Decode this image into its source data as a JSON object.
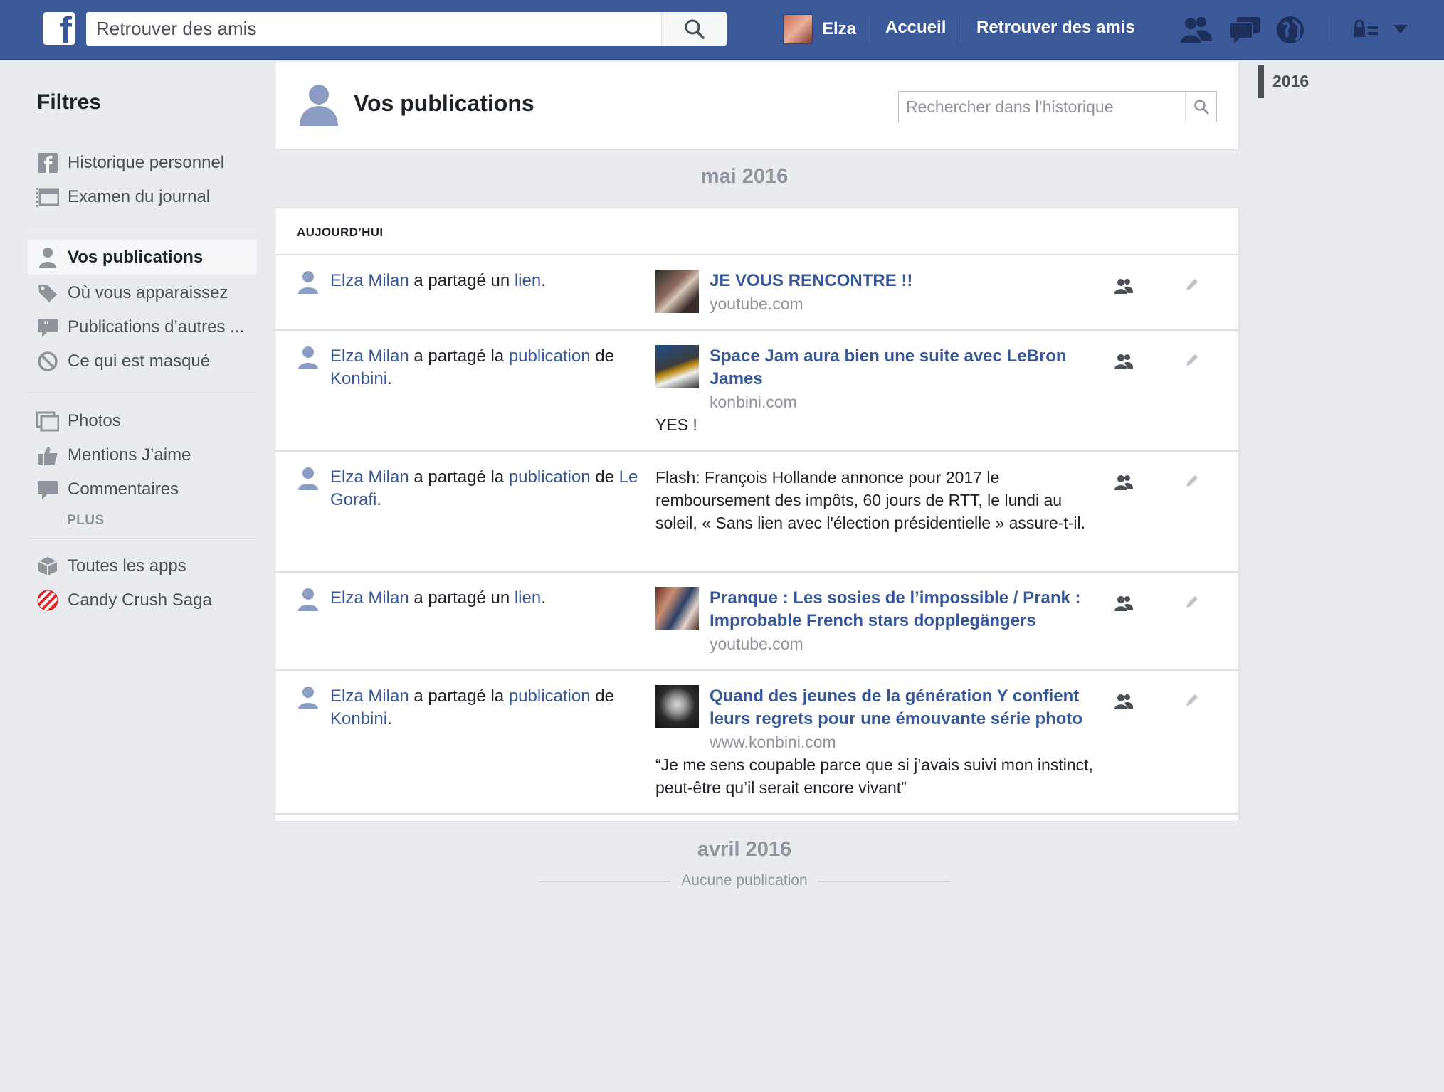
{
  "topbar": {
    "search_placeholder": "Retrouver des amis",
    "user_name": "Elza",
    "nav_home": "Accueil",
    "nav_find_friends": "Retrouver des amis"
  },
  "sidebar": {
    "title": "Filtres",
    "items": [
      {
        "label": "Historique personnel",
        "icon": "facebook-square-icon"
      },
      {
        "label": "Examen du journal",
        "icon": "timeline-review-icon"
      },
      {
        "label": "Vos publications",
        "icon": "person-icon",
        "active": true
      },
      {
        "label": "Où vous apparaissez",
        "icon": "tag-icon"
      },
      {
        "label": "Publications d’autres ...",
        "icon": "quote-bubble-icon"
      },
      {
        "label": "Ce qui est masqué",
        "icon": "hidden-icon"
      },
      {
        "label": "Photos",
        "icon": "photos-icon"
      },
      {
        "label": "Mentions J’aime",
        "icon": "thumbs-up-icon"
      },
      {
        "label": "Commentaires",
        "icon": "comment-icon"
      },
      {
        "label": "Toutes les apps",
        "icon": "apps-cube-icon"
      },
      {
        "label": "Candy Crush Saga",
        "icon": "candy-crush-icon"
      }
    ],
    "more_label": "PLUS"
  },
  "header": {
    "title": "Vos publications",
    "search_placeholder": "Rechercher dans l’historique"
  },
  "months": {
    "may": "mai 2016",
    "april": "avril 2016",
    "april_empty": "Aucune publication"
  },
  "feed": {
    "section_label": "AUJOURD’HUI",
    "posts": [
      {
        "actor": "Elza Milan",
        "verb": " a partagé un ",
        "object": "lien",
        "suffix": ".",
        "link_title": "JE VOUS RENCONTRE !!",
        "domain": "youtube.com",
        "caption": ""
      },
      {
        "actor": "Elza Milan",
        "verb": " a partagé la ",
        "object": "publication",
        "de": " de ",
        "source": "Konbini",
        "suffix": ".",
        "link_title": "Space Jam aura bien une suite avec LeBron James",
        "domain": "konbini.com",
        "caption": "YES !"
      },
      {
        "actor": "Elza Milan",
        "verb": " a partagé la ",
        "object": "publication",
        "de": " de ",
        "source": "Le Gorafi",
        "suffix": ".",
        "text": "Flash: François Hollande annonce pour 2017 le remboursement des impôts, 60 jours de RTT, le lundi au soleil, « Sans lien avec l'élection présidentielle » assure-t-il."
      },
      {
        "actor": "Elza Milan",
        "verb": " a partagé un ",
        "object": "lien",
        "suffix": ".",
        "link_title": "Pranque : Les sosies de l’impossible / Prank : Improbable French stars dopplegängers",
        "domain": "youtube.com"
      },
      {
        "actor": "Elza Milan",
        "verb": " a partagé la ",
        "object": "publication",
        "de": " de ",
        "source": "Konbini",
        "suffix": ".",
        "link_title": "Quand des jeunes de la génération Y confient leurs regrets pour une émouvante série photo",
        "domain": "www.konbini.com",
        "caption": "“Je me sens coupable parce que si j’avais suivi mon instinct, peut-être qu’il serait encore vivant”"
      }
    ]
  },
  "timeline": {
    "year": "2016"
  },
  "colors": {
    "brand": "#3b5998",
    "link": "#365899",
    "background": "#e9ebee"
  }
}
